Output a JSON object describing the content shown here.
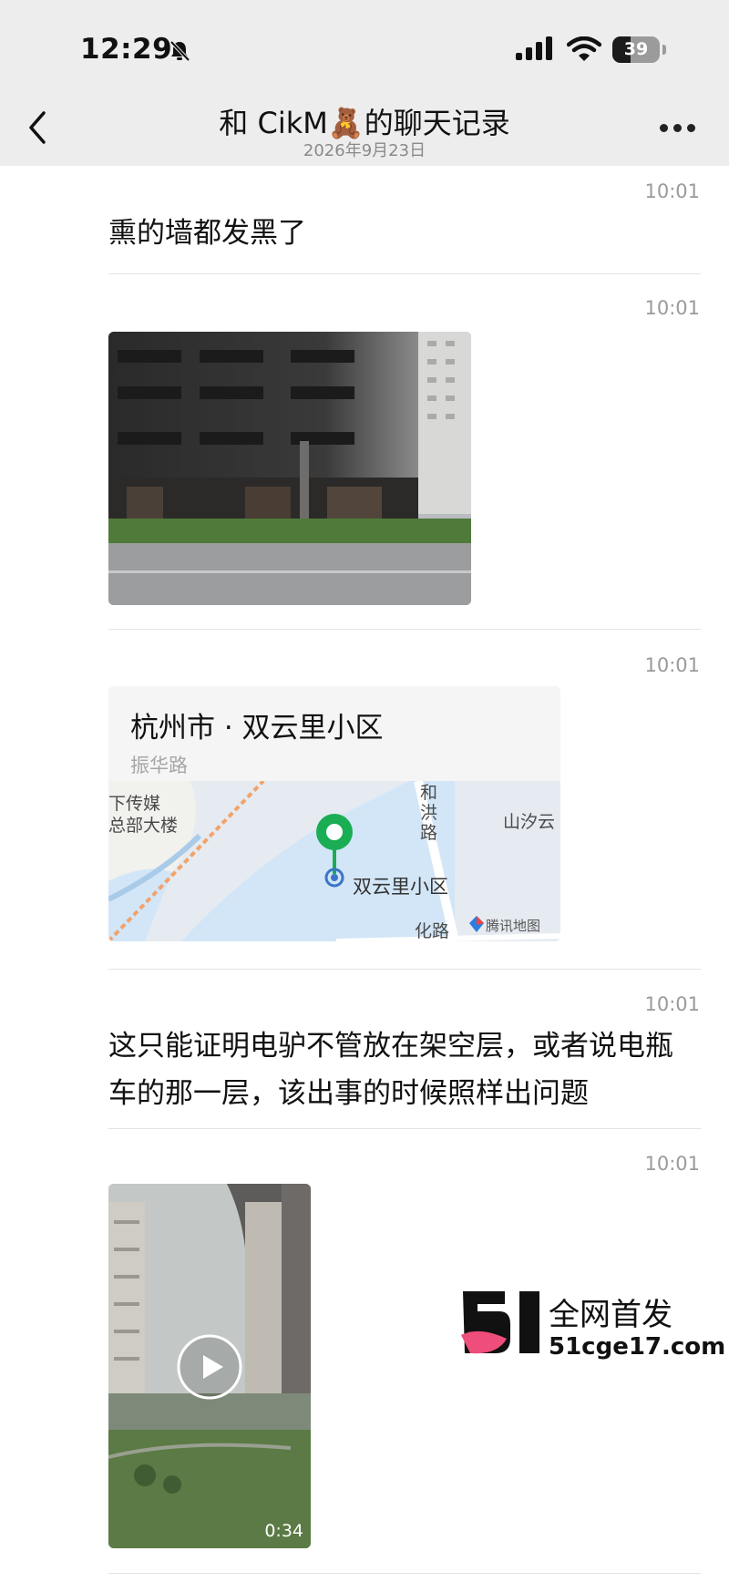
{
  "status_bar": {
    "time": "12:29",
    "battery": "39",
    "battery_level": 0.39,
    "icons": [
      "bell-muted-icon",
      "signal-icon",
      "wifi-icon",
      "battery-icon"
    ]
  },
  "nav": {
    "title": "和 CikM🧸的聊天记录",
    "subtitle": "2026年9月23日",
    "back_icon": "chevron-left-icon",
    "more_icon": "more-horizontal-icon"
  },
  "messages": [
    {
      "time": "10:01",
      "text": "熏的墙都发黑了"
    },
    {
      "time": "10:01",
      "image": "burnt-building-photo"
    },
    {
      "time": "10:01",
      "location": {
        "name": "杭州市 · 双云里小区",
        "address": "振华路"
      }
    },
    {
      "time": "10:01",
      "text": "这只能证明电驴不管放在架空层，或者说电瓶车的那一层，该出事的时候照样出问题"
    },
    {
      "time": "10:01",
      "video": {
        "duration": "0:34"
      }
    }
  ],
  "map": {
    "labels": [
      "下传媒",
      "总部大楼",
      "和洪路",
      "山汐云",
      "化路"
    ],
    "destination": "双云里小区",
    "credit": "腾讯地图",
    "pin_color": "#1aad53"
  },
  "watermark": {
    "logo_text": "51",
    "tagline": "全网首发",
    "url": "51cge17.com"
  },
  "colors": {
    "bar_bg": "#ededed",
    "pin_green": "#1aad53",
    "watermark_pink": "#ef4d7a"
  }
}
